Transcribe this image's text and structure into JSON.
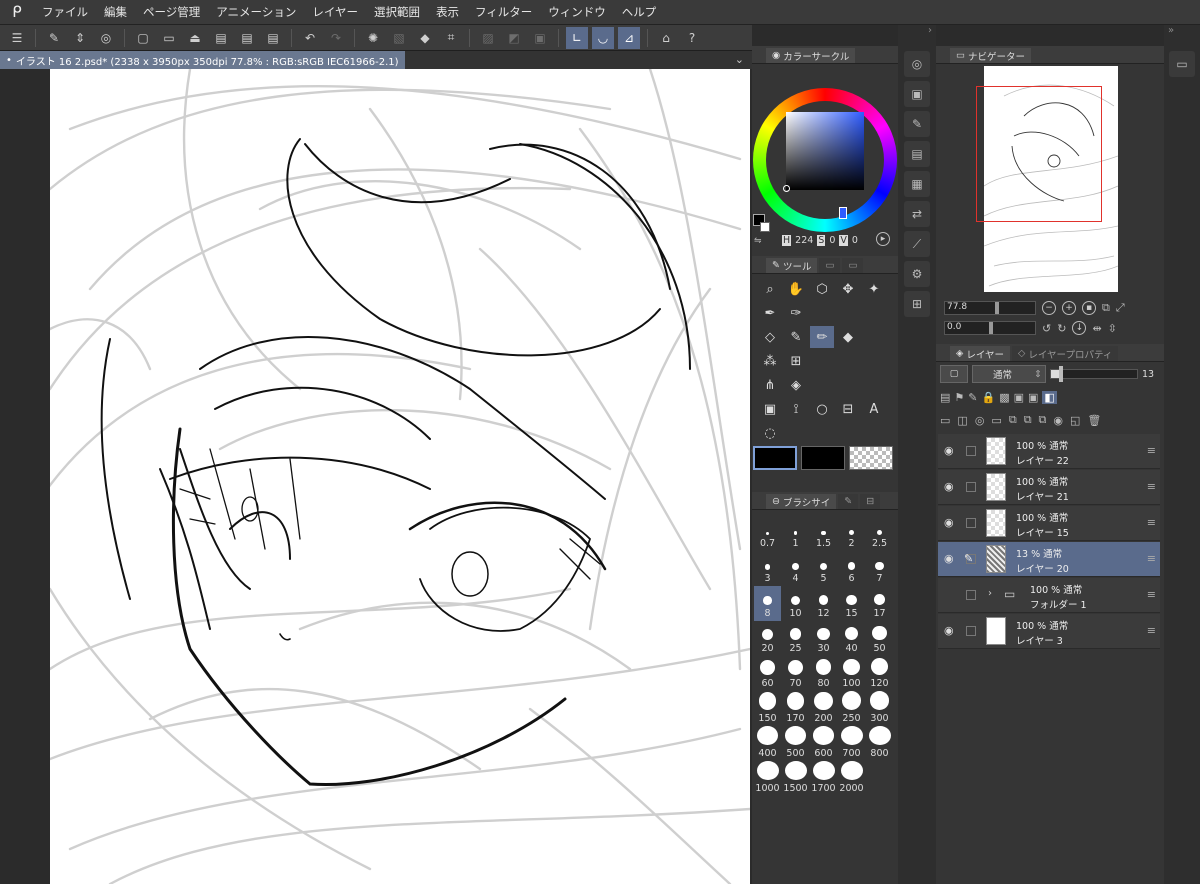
{
  "menu": [
    "ファイル",
    "編集",
    "ページ管理",
    "アニメーション",
    "レイヤー",
    "選択範囲",
    "表示",
    "フィルター",
    "ウィンドウ",
    "ヘルプ"
  ],
  "document_tab": "イラスト 16 2.psd* (2338 x 3950px 350dpi 77.8% : RGB:sRGB IEC61966-2.1)",
  "panels": {
    "color_tab": "カラーサークル",
    "tool_tab": "ツール",
    "brush_tab": "ブラシサイ",
    "navigator_tab": "ナビゲーター",
    "layer_tab": "レイヤー",
    "layer_prop_tab": "レイヤープロパティ"
  },
  "color": {
    "hsv_h": "224",
    "hsv_s": "0",
    "hsv_v": "0",
    "hsv_s_label": "S",
    "hsv_v_label": "V",
    "main_color": "#000000",
    "sub_color": "#ffffff"
  },
  "navigator": {
    "zoom": "77.8",
    "angle": "0.0"
  },
  "brush_sizes": [
    "0.7",
    "1",
    "1.5",
    "2",
    "2.5",
    "3",
    "4",
    "5",
    "6",
    "7",
    "8",
    "10",
    "12",
    "15",
    "17",
    "20",
    "25",
    "30",
    "40",
    "50",
    "60",
    "70",
    "80",
    "100",
    "120",
    "150",
    "170",
    "200",
    "250",
    "300",
    "400",
    "500",
    "600",
    "700",
    "800",
    "1000",
    "1500",
    "1700",
    "2000"
  ],
  "selected_brush_size": "8",
  "layer_controls": {
    "blend_mode": "通常",
    "opacity": "13"
  },
  "layers": [
    {
      "opacity": "100 %",
      "mode": "通常",
      "name": "レイヤー 22",
      "visible": true,
      "selected": false
    },
    {
      "opacity": "100 %",
      "mode": "通常",
      "name": "レイヤー 21",
      "visible": true,
      "selected": false
    },
    {
      "opacity": "100 %",
      "mode": "通常",
      "name": "レイヤー 15",
      "visible": true,
      "selected": false
    },
    {
      "opacity": "13 %",
      "mode": "通常",
      "name": "レイヤー 20",
      "visible": true,
      "selected": true
    },
    {
      "opacity": "100 %",
      "mode": "通常",
      "name": "フォルダー 1",
      "visible": false,
      "selected": false
    },
    {
      "opacity": "100 %",
      "mode": "通常",
      "name": "レイヤー 3",
      "visible": true,
      "selected": false
    }
  ]
}
